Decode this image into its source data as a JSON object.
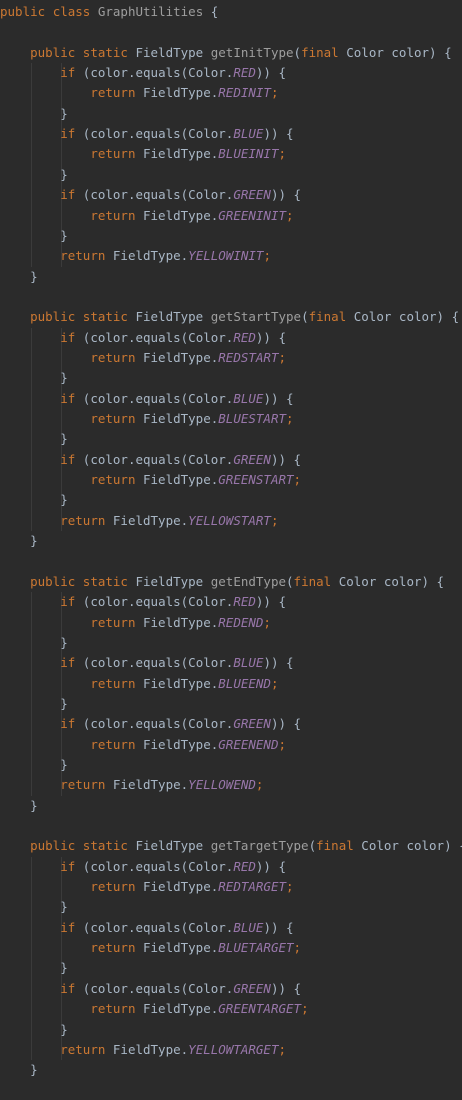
{
  "editor": {
    "theme": {
      "background": "#2b2b2b",
      "keyword": "#cc7832",
      "text": "#a9b7c6",
      "constant": "#9876aa",
      "method_name": "#9e9e9e"
    },
    "lines": [
      [
        {
          "t": "public",
          "c": "kw"
        },
        {
          "t": " ",
          "c": "txt"
        },
        {
          "t": "class",
          "c": "kw"
        },
        {
          "t": " ",
          "c": "txt"
        },
        {
          "t": "GraphUtilities",
          "c": "meth"
        },
        {
          "t": " {",
          "c": "txt"
        }
      ],
      [],
      [
        {
          "t": "    ",
          "c": "txt"
        },
        {
          "t": "public",
          "c": "kw"
        },
        {
          "t": " ",
          "c": "txt"
        },
        {
          "t": "static",
          "c": "kw"
        },
        {
          "t": " FieldType ",
          "c": "txt"
        },
        {
          "t": "getInitType",
          "c": "meth"
        },
        {
          "t": "(",
          "c": "txt"
        },
        {
          "t": "final",
          "c": "kw"
        },
        {
          "t": " Color color) {",
          "c": "txt"
        }
      ],
      [
        {
          "t": "        ",
          "c": "txt"
        },
        {
          "t": "if",
          "c": "kw"
        },
        {
          "t": " (color.equals(Color.",
          "c": "txt"
        },
        {
          "t": "RED",
          "c": "cst"
        },
        {
          "t": ")) {",
          "c": "txt"
        }
      ],
      [
        {
          "t": "            ",
          "c": "txt"
        },
        {
          "t": "return",
          "c": "kw"
        },
        {
          "t": " FieldType.",
          "c": "txt"
        },
        {
          "t": "REDINIT",
          "c": "cst"
        },
        {
          "t": ";",
          "c": "kw"
        }
      ],
      [
        {
          "t": "        }",
          "c": "txt"
        }
      ],
      [
        {
          "t": "        ",
          "c": "txt"
        },
        {
          "t": "if",
          "c": "kw"
        },
        {
          "t": " (color.equals(Color.",
          "c": "txt"
        },
        {
          "t": "BLUE",
          "c": "cst"
        },
        {
          "t": ")) {",
          "c": "txt"
        }
      ],
      [
        {
          "t": "            ",
          "c": "txt"
        },
        {
          "t": "return",
          "c": "kw"
        },
        {
          "t": " FieldType.",
          "c": "txt"
        },
        {
          "t": "BLUEINIT",
          "c": "cst"
        },
        {
          "t": ";",
          "c": "kw"
        }
      ],
      [
        {
          "t": "        }",
          "c": "txt"
        }
      ],
      [
        {
          "t": "        ",
          "c": "txt"
        },
        {
          "t": "if",
          "c": "kw"
        },
        {
          "t": " (color.equals(Color.",
          "c": "txt"
        },
        {
          "t": "GREEN",
          "c": "cst"
        },
        {
          "t": ")) {",
          "c": "txt"
        }
      ],
      [
        {
          "t": "            ",
          "c": "txt"
        },
        {
          "t": "return",
          "c": "kw"
        },
        {
          "t": " FieldType.",
          "c": "txt"
        },
        {
          "t": "GREENINIT",
          "c": "cst"
        },
        {
          "t": ";",
          "c": "kw"
        }
      ],
      [
        {
          "t": "        }",
          "c": "txt"
        }
      ],
      [
        {
          "t": "        ",
          "c": "txt"
        },
        {
          "t": "return",
          "c": "kw"
        },
        {
          "t": " FieldType.",
          "c": "txt"
        },
        {
          "t": "YELLOWINIT",
          "c": "cst"
        },
        {
          "t": ";",
          "c": "kw"
        }
      ],
      [
        {
          "t": "    }",
          "c": "txt"
        }
      ],
      [],
      [
        {
          "t": "    ",
          "c": "txt"
        },
        {
          "t": "public",
          "c": "kw"
        },
        {
          "t": " ",
          "c": "txt"
        },
        {
          "t": "static",
          "c": "kw"
        },
        {
          "t": " FieldType ",
          "c": "txt"
        },
        {
          "t": "getStartType",
          "c": "meth"
        },
        {
          "t": "(",
          "c": "txt"
        },
        {
          "t": "final",
          "c": "kw"
        },
        {
          "t": " Color color) {",
          "c": "txt"
        }
      ],
      [
        {
          "t": "        ",
          "c": "txt"
        },
        {
          "t": "if",
          "c": "kw"
        },
        {
          "t": " (color.equals(Color.",
          "c": "txt"
        },
        {
          "t": "RED",
          "c": "cst"
        },
        {
          "t": ")) {",
          "c": "txt"
        }
      ],
      [
        {
          "t": "            ",
          "c": "txt"
        },
        {
          "t": "return",
          "c": "kw"
        },
        {
          "t": " FieldType.",
          "c": "txt"
        },
        {
          "t": "REDSTART",
          "c": "cst"
        },
        {
          "t": ";",
          "c": "kw"
        }
      ],
      [
        {
          "t": "        }",
          "c": "txt"
        }
      ],
      [
        {
          "t": "        ",
          "c": "txt"
        },
        {
          "t": "if",
          "c": "kw"
        },
        {
          "t": " (color.equals(Color.",
          "c": "txt"
        },
        {
          "t": "BLUE",
          "c": "cst"
        },
        {
          "t": ")) {",
          "c": "txt"
        }
      ],
      [
        {
          "t": "            ",
          "c": "txt"
        },
        {
          "t": "return",
          "c": "kw"
        },
        {
          "t": " FieldType.",
          "c": "txt"
        },
        {
          "t": "BLUESTART",
          "c": "cst"
        },
        {
          "t": ";",
          "c": "kw"
        }
      ],
      [
        {
          "t": "        }",
          "c": "txt"
        }
      ],
      [
        {
          "t": "        ",
          "c": "txt"
        },
        {
          "t": "if",
          "c": "kw"
        },
        {
          "t": " (color.equals(Color.",
          "c": "txt"
        },
        {
          "t": "GREEN",
          "c": "cst"
        },
        {
          "t": ")) {",
          "c": "txt"
        }
      ],
      [
        {
          "t": "            ",
          "c": "txt"
        },
        {
          "t": "return",
          "c": "kw"
        },
        {
          "t": " FieldType.",
          "c": "txt"
        },
        {
          "t": "GREENSTART",
          "c": "cst"
        },
        {
          "t": ";",
          "c": "kw"
        }
      ],
      [
        {
          "t": "        }",
          "c": "txt"
        }
      ],
      [
        {
          "t": "        ",
          "c": "txt"
        },
        {
          "t": "return",
          "c": "kw"
        },
        {
          "t": " FieldType.",
          "c": "txt"
        },
        {
          "t": "YELLOWSTART",
          "c": "cst"
        },
        {
          "t": ";",
          "c": "kw"
        }
      ],
      [
        {
          "t": "    }",
          "c": "txt"
        }
      ],
      [],
      [
        {
          "t": "    ",
          "c": "txt"
        },
        {
          "t": "public",
          "c": "kw"
        },
        {
          "t": " ",
          "c": "txt"
        },
        {
          "t": "static",
          "c": "kw"
        },
        {
          "t": " FieldType ",
          "c": "txt"
        },
        {
          "t": "getEndType",
          "c": "meth"
        },
        {
          "t": "(",
          "c": "txt"
        },
        {
          "t": "final",
          "c": "kw"
        },
        {
          "t": " Color color) {",
          "c": "txt"
        }
      ],
      [
        {
          "t": "        ",
          "c": "txt"
        },
        {
          "t": "if",
          "c": "kw"
        },
        {
          "t": " (color.equals(Color.",
          "c": "txt"
        },
        {
          "t": "RED",
          "c": "cst"
        },
        {
          "t": ")) {",
          "c": "txt"
        }
      ],
      [
        {
          "t": "            ",
          "c": "txt"
        },
        {
          "t": "return",
          "c": "kw"
        },
        {
          "t": " FieldType.",
          "c": "txt"
        },
        {
          "t": "REDEND",
          "c": "cst"
        },
        {
          "t": ";",
          "c": "kw"
        }
      ],
      [
        {
          "t": "        }",
          "c": "txt"
        }
      ],
      [
        {
          "t": "        ",
          "c": "txt"
        },
        {
          "t": "if",
          "c": "kw"
        },
        {
          "t": " (color.equals(Color.",
          "c": "txt"
        },
        {
          "t": "BLUE",
          "c": "cst"
        },
        {
          "t": ")) {",
          "c": "txt"
        }
      ],
      [
        {
          "t": "            ",
          "c": "txt"
        },
        {
          "t": "return",
          "c": "kw"
        },
        {
          "t": " FieldType.",
          "c": "txt"
        },
        {
          "t": "BLUEEND",
          "c": "cst"
        },
        {
          "t": ";",
          "c": "kw"
        }
      ],
      [
        {
          "t": "        }",
          "c": "txt"
        }
      ],
      [
        {
          "t": "        ",
          "c": "txt"
        },
        {
          "t": "if",
          "c": "kw"
        },
        {
          "t": " (color.equals(Color.",
          "c": "txt"
        },
        {
          "t": "GREEN",
          "c": "cst"
        },
        {
          "t": ")) {",
          "c": "txt"
        }
      ],
      [
        {
          "t": "            ",
          "c": "txt"
        },
        {
          "t": "return",
          "c": "kw"
        },
        {
          "t": " FieldType.",
          "c": "txt"
        },
        {
          "t": "GREENEND",
          "c": "cst"
        },
        {
          "t": ";",
          "c": "kw"
        }
      ],
      [
        {
          "t": "        }",
          "c": "txt"
        }
      ],
      [
        {
          "t": "        ",
          "c": "txt"
        },
        {
          "t": "return",
          "c": "kw"
        },
        {
          "t": " FieldType.",
          "c": "txt"
        },
        {
          "t": "YELLOWEND",
          "c": "cst"
        },
        {
          "t": ";",
          "c": "kw"
        }
      ],
      [
        {
          "t": "    }",
          "c": "txt"
        }
      ],
      [],
      [
        {
          "t": "    ",
          "c": "txt"
        },
        {
          "t": "public",
          "c": "kw"
        },
        {
          "t": " ",
          "c": "txt"
        },
        {
          "t": "static",
          "c": "kw"
        },
        {
          "t": " FieldType ",
          "c": "txt"
        },
        {
          "t": "getTargetType",
          "c": "meth"
        },
        {
          "t": "(",
          "c": "txt"
        },
        {
          "t": "final",
          "c": "kw"
        },
        {
          "t": " Color color) {",
          "c": "txt"
        }
      ],
      [
        {
          "t": "        ",
          "c": "txt"
        },
        {
          "t": "if",
          "c": "kw"
        },
        {
          "t": " (color.equals(Color.",
          "c": "txt"
        },
        {
          "t": "RED",
          "c": "cst"
        },
        {
          "t": ")) {",
          "c": "txt"
        }
      ],
      [
        {
          "t": "            ",
          "c": "txt"
        },
        {
          "t": "return",
          "c": "kw"
        },
        {
          "t": " FieldType.",
          "c": "txt"
        },
        {
          "t": "REDTARGET",
          "c": "cst"
        },
        {
          "t": ";",
          "c": "kw"
        }
      ],
      [
        {
          "t": "        }",
          "c": "txt"
        }
      ],
      [
        {
          "t": "        ",
          "c": "txt"
        },
        {
          "t": "if",
          "c": "kw"
        },
        {
          "t": " (color.equals(Color.",
          "c": "txt"
        },
        {
          "t": "BLUE",
          "c": "cst"
        },
        {
          "t": ")) {",
          "c": "txt"
        }
      ],
      [
        {
          "t": "            ",
          "c": "txt"
        },
        {
          "t": "return",
          "c": "kw"
        },
        {
          "t": " FieldType.",
          "c": "txt"
        },
        {
          "t": "BLUETARGET",
          "c": "cst"
        },
        {
          "t": ";",
          "c": "kw"
        }
      ],
      [
        {
          "t": "        }",
          "c": "txt"
        }
      ],
      [
        {
          "t": "        ",
          "c": "txt"
        },
        {
          "t": "if",
          "c": "kw"
        },
        {
          "t": " (color.equals(Color.",
          "c": "txt"
        },
        {
          "t": "GREEN",
          "c": "cst"
        },
        {
          "t": ")) {",
          "c": "txt"
        }
      ],
      [
        {
          "t": "            ",
          "c": "txt"
        },
        {
          "t": "return",
          "c": "kw"
        },
        {
          "t": " FieldType.",
          "c": "txt"
        },
        {
          "t": "GREENTARGET",
          "c": "cst"
        },
        {
          "t": ";",
          "c": "kw"
        }
      ],
      [
        {
          "t": "        }",
          "c": "txt"
        }
      ],
      [
        {
          "t": "        ",
          "c": "txt"
        },
        {
          "t": "return",
          "c": "kw"
        },
        {
          "t": " FieldType.",
          "c": "txt"
        },
        {
          "t": "YELLOWTARGET",
          "c": "cst"
        },
        {
          "t": ";",
          "c": "kw"
        }
      ],
      [
        {
          "t": "    }",
          "c": "txt"
        }
      ],
      [],
      [
        {
          "t": "}",
          "c": "txt"
        }
      ]
    ]
  }
}
